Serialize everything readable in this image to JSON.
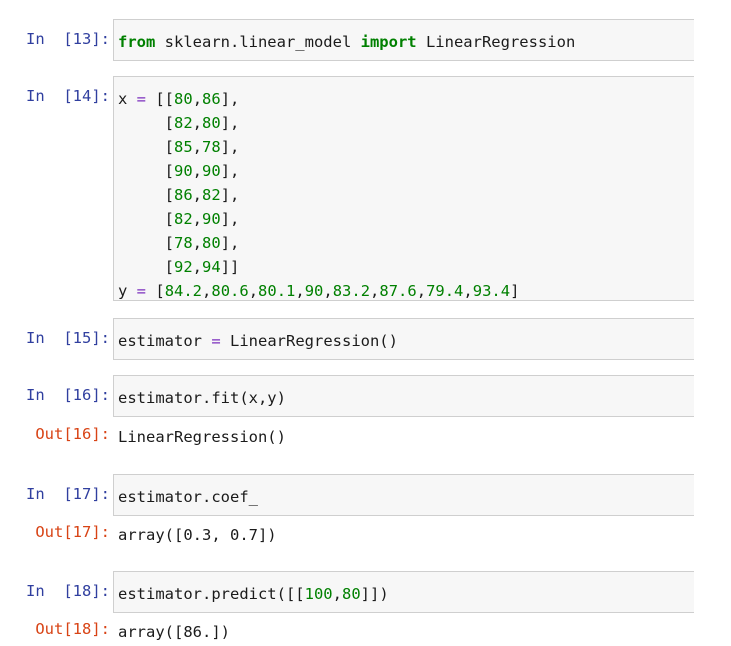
{
  "cells": [
    {
      "in_prompt": "In  [13]:",
      "code": [
        [
          {
            "t": "from",
            "c": "kw"
          },
          {
            "t": " sklearn.linear_model "
          },
          {
            "t": "import",
            "c": "kw"
          },
          {
            "t": " LinearRegression"
          }
        ]
      ]
    },
    {
      "in_prompt": "In  [14]:",
      "code": [
        [
          {
            "t": "x "
          },
          {
            "t": "=",
            "c": "op"
          },
          {
            "t": " [["
          },
          {
            "t": "80",
            "c": "num"
          },
          {
            "t": ","
          },
          {
            "t": "86",
            "c": "num"
          },
          {
            "t": "],"
          }
        ],
        [
          {
            "t": "     ["
          },
          {
            "t": "82",
            "c": "num"
          },
          {
            "t": ","
          },
          {
            "t": "80",
            "c": "num"
          },
          {
            "t": "],"
          }
        ],
        [
          {
            "t": "     ["
          },
          {
            "t": "85",
            "c": "num"
          },
          {
            "t": ","
          },
          {
            "t": "78",
            "c": "num"
          },
          {
            "t": "],"
          }
        ],
        [
          {
            "t": "     ["
          },
          {
            "t": "90",
            "c": "num"
          },
          {
            "t": ","
          },
          {
            "t": "90",
            "c": "num"
          },
          {
            "t": "],"
          }
        ],
        [
          {
            "t": "     ["
          },
          {
            "t": "86",
            "c": "num"
          },
          {
            "t": ","
          },
          {
            "t": "82",
            "c": "num"
          },
          {
            "t": "],"
          }
        ],
        [
          {
            "t": "     ["
          },
          {
            "t": "82",
            "c": "num"
          },
          {
            "t": ","
          },
          {
            "t": "90",
            "c": "num"
          },
          {
            "t": "],"
          }
        ],
        [
          {
            "t": "     ["
          },
          {
            "t": "78",
            "c": "num"
          },
          {
            "t": ","
          },
          {
            "t": "80",
            "c": "num"
          },
          {
            "t": "],"
          }
        ],
        [
          {
            "t": "     ["
          },
          {
            "t": "92",
            "c": "num"
          },
          {
            "t": ","
          },
          {
            "t": "94",
            "c": "num"
          },
          {
            "t": "]]"
          }
        ],
        [
          {
            "t": "y "
          },
          {
            "t": "=",
            "c": "op"
          },
          {
            "t": " ["
          },
          {
            "t": "84.2",
            "c": "num"
          },
          {
            "t": ","
          },
          {
            "t": "80.6",
            "c": "num"
          },
          {
            "t": ","
          },
          {
            "t": "80.1",
            "c": "num"
          },
          {
            "t": ","
          },
          {
            "t": "90",
            "c": "num"
          },
          {
            "t": ","
          },
          {
            "t": "83.2",
            "c": "num"
          },
          {
            "t": ","
          },
          {
            "t": "87.6",
            "c": "num"
          },
          {
            "t": ","
          },
          {
            "t": "79.4",
            "c": "num"
          },
          {
            "t": ","
          },
          {
            "t": "93.4",
            "c": "num"
          },
          {
            "t": "]"
          }
        ]
      ]
    },
    {
      "in_prompt": "In  [15]:",
      "code": [
        [
          {
            "t": "estimator "
          },
          {
            "t": "=",
            "c": "op"
          },
          {
            "t": " LinearRegression()"
          }
        ]
      ]
    },
    {
      "in_prompt": "In  [16]:",
      "code": [
        [
          {
            "t": "estimator.fit(x,y)"
          }
        ]
      ],
      "out_prompt": "Out[16]:",
      "output": "LinearRegression()"
    },
    {
      "in_prompt": "In  [17]:",
      "code": [
        [
          {
            "t": "estimator.coef_"
          }
        ]
      ],
      "out_prompt": "Out[17]:",
      "output": "array([0.3, 0.7])"
    },
    {
      "in_prompt": "In  [18]:",
      "code": [
        [
          {
            "t": "estimator.predict([["
          },
          {
            "t": "100",
            "c": "num"
          },
          {
            "t": ","
          },
          {
            "t": "80",
            "c": "num"
          },
          {
            "t": "]])"
          }
        ]
      ],
      "out_prompt": "Out[18]:",
      "output": "array([86.])"
    }
  ]
}
